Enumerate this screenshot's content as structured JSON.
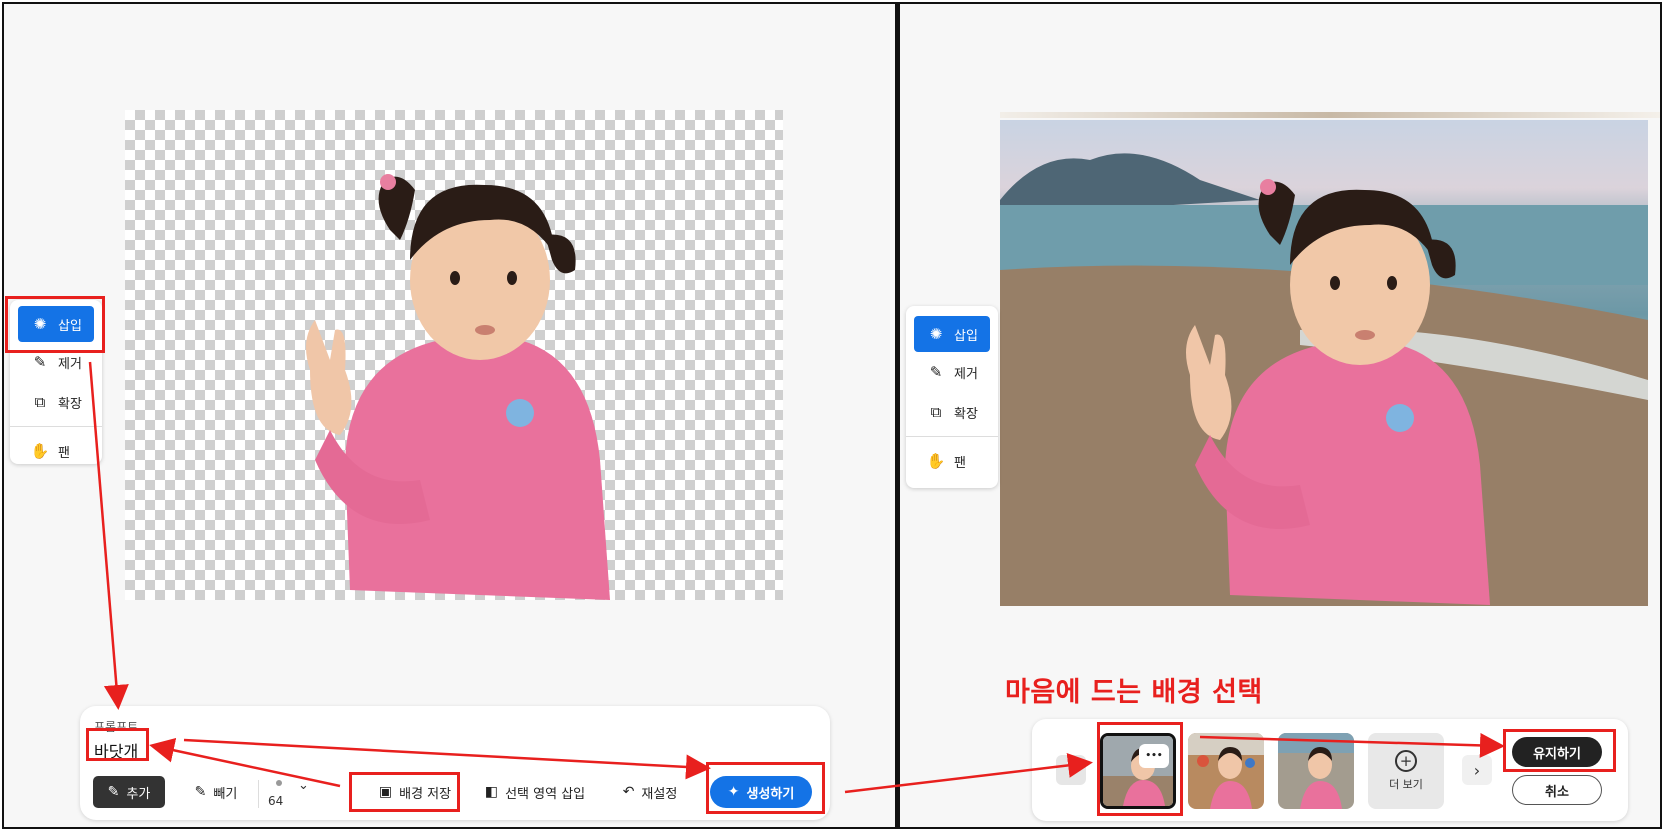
{
  "tools": {
    "insert": "삽입",
    "remove": "제거",
    "expand": "확장",
    "pan": "팬"
  },
  "prompt": {
    "label": "프롬프트",
    "value": "바닷개",
    "add": "추가",
    "subtract": "빼기",
    "brush_size": "64",
    "save_background": "배경 저장",
    "insert_selection": "선택 영역 삽입",
    "reset": "재설정",
    "generate": "생성하기"
  },
  "variations": {
    "more": "더 보기",
    "keep": "유지하기",
    "cancel": "취소",
    "dots": "•••"
  },
  "annotation": "마음에 드는 배경 선택",
  "colors": {
    "accent": "#1473e6",
    "annotation_red": "#e8201e"
  }
}
